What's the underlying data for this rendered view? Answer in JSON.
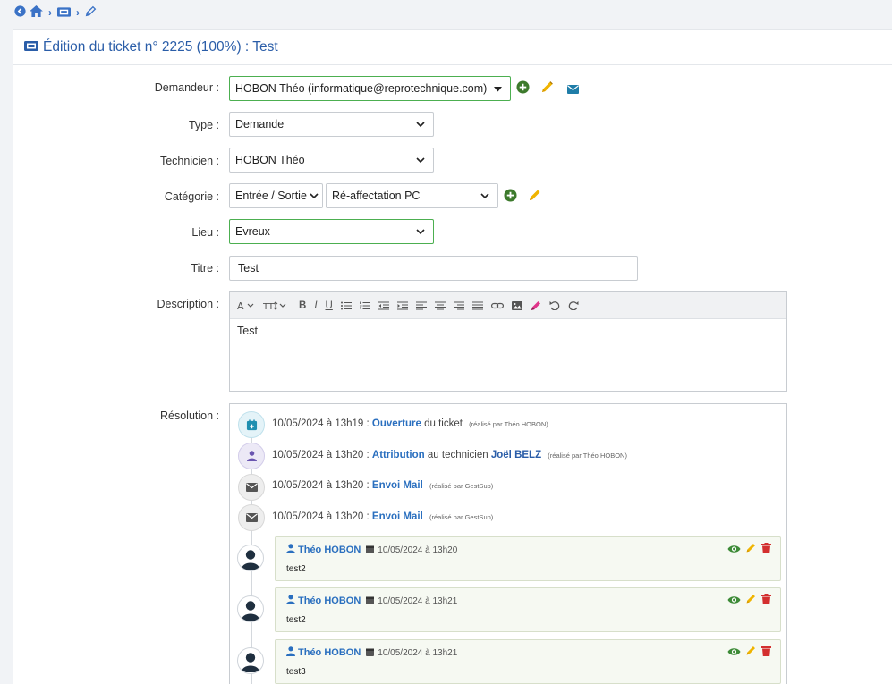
{
  "header": {
    "title": "Édition du ticket n° 2225 (100%) : Test"
  },
  "form": {
    "demandeur_label": "Demandeur :",
    "demandeur_value": "HOBON Théo (informatique@reprotechnique.com)",
    "type_label": "Type :",
    "type_value": "Demande",
    "technicien_label": "Technicien :",
    "technicien_value": "HOBON Théo",
    "categorie_label": "Catégorie :",
    "categorie_value": "Entrée / Sortie",
    "souscategorie_value": "Ré-affectation PC",
    "lieu_label": "Lieu :",
    "lieu_value": "Evreux",
    "titre_label": "Titre :",
    "titre_value": "Test",
    "description_label": "Description :",
    "description_value": "Test",
    "resolution_label": "Résolution :"
  },
  "timeline": {
    "events": [
      {
        "date": "10/05/2024 à 13h19 :",
        "action": "Ouverture",
        "rest": " du ticket",
        "by": "(réalisé par Théo HOBON)"
      },
      {
        "date": "10/05/2024 à 13h20 :",
        "action": "Attribution",
        "rest": " au technicien ",
        "tech": "Joël BELZ",
        "by": "(réalisé par Théo HOBON)"
      },
      {
        "date": "10/05/2024 à 13h20 :",
        "action": "Envoi Mail",
        "by": "(réalisé par GestSup)"
      },
      {
        "date": "10/05/2024 à 13h20 :",
        "action": "Envoi Mail",
        "by": "(réalisé par GestSup)"
      }
    ],
    "posts": [
      {
        "user": "Théo HOBON",
        "date": "10/05/2024 à 13h20",
        "text": "test2"
      },
      {
        "user": "Théo HOBON",
        "date": "10/05/2024 à 13h21",
        "text": "test2"
      },
      {
        "user": "Théo HOBON",
        "date": "10/05/2024 à 13h21",
        "text": "test3"
      }
    ]
  },
  "colors": {
    "accent": "#2a5da8",
    "success": "#3d8b37",
    "warning": "#f0b400",
    "danger": "#d32f2f",
    "mail": "#1f7da8"
  },
  "icons": [
    "back-icon",
    "home-icon",
    "ticket-icon",
    "pencil-icon",
    "plus-icon",
    "envelope-icon",
    "eye-icon",
    "trash-icon",
    "user-icon",
    "calendar-icon"
  ]
}
